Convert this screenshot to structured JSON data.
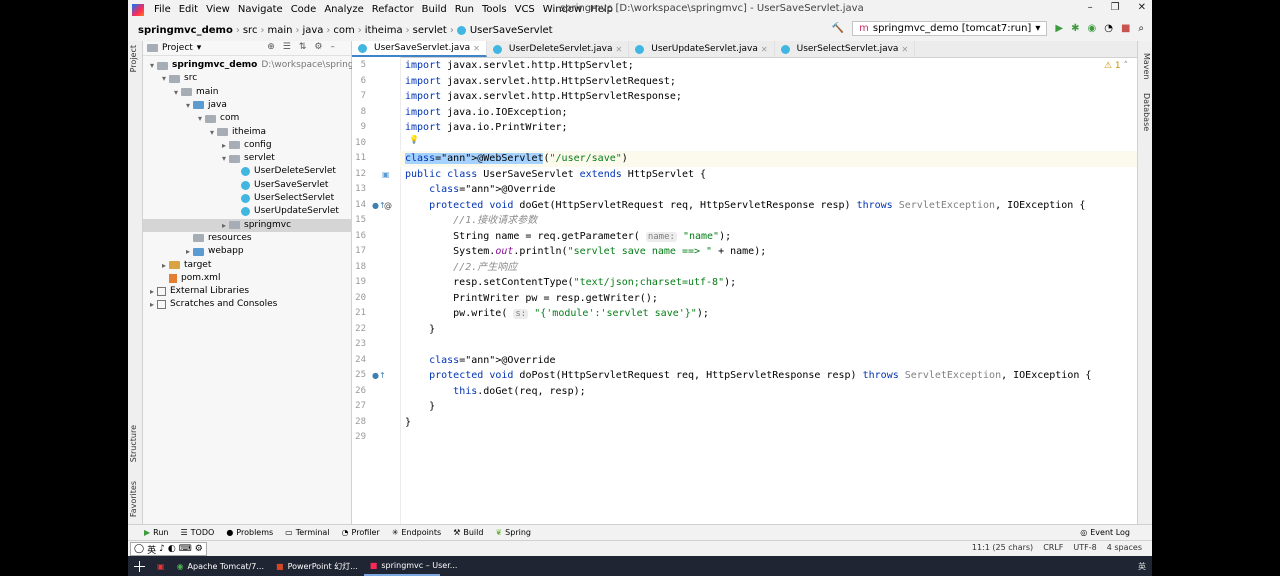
{
  "window": {
    "title": "springmvc [D:\\workspace\\springmvc] - UserSaveServlet.java",
    "menu": [
      "File",
      "Edit",
      "View",
      "Navigate",
      "Code",
      "Analyze",
      "Refactor",
      "Build",
      "Run",
      "Tools",
      "VCS",
      "Window",
      "Help"
    ],
    "controls": [
      "–",
      "❐",
      "✕"
    ]
  },
  "breadcrumb": [
    "springmvc_demo",
    "src",
    "main",
    "java",
    "com",
    "itheima",
    "servlet",
    "UserSaveServlet"
  ],
  "run_config": "springmvc_demo [tomcat7:run]",
  "project": {
    "header": "Project",
    "tree": [
      {
        "label": "springmvc_demo",
        "path": "D:\\workspace\\springmvc",
        "indent": 0,
        "arrow": "▾",
        "icon": "fold grey"
      },
      {
        "label": "src",
        "indent": 1,
        "arrow": "▾",
        "icon": "fold grey"
      },
      {
        "label": "main",
        "indent": 2,
        "arrow": "▾",
        "icon": "fold grey"
      },
      {
        "label": "java",
        "indent": 3,
        "arrow": "▾",
        "icon": "fold blue"
      },
      {
        "label": "com",
        "indent": 4,
        "arrow": "▾",
        "icon": "fold grey"
      },
      {
        "label": "itheima",
        "indent": 5,
        "arrow": "▾",
        "icon": "fold grey"
      },
      {
        "label": "config",
        "indent": 6,
        "arrow": "▸",
        "icon": "fold grey"
      },
      {
        "label": "servlet",
        "indent": 6,
        "arrow": "▾",
        "icon": "fold grey"
      },
      {
        "label": "UserDeleteServlet",
        "indent": 7,
        "arrow": "",
        "icon": "cls"
      },
      {
        "label": "UserSaveServlet",
        "indent": 7,
        "arrow": "",
        "icon": "cls"
      },
      {
        "label": "UserSelectServlet",
        "indent": 7,
        "arrow": "",
        "icon": "cls"
      },
      {
        "label": "UserUpdateServlet",
        "indent": 7,
        "arrow": "",
        "icon": "cls"
      },
      {
        "label": "springmvc",
        "indent": 6,
        "arrow": "▸",
        "icon": "fold grey",
        "selected": true
      },
      {
        "label": "resources",
        "indent": 3,
        "arrow": "",
        "icon": "fold grey"
      },
      {
        "label": "webapp",
        "indent": 3,
        "arrow": "▸",
        "icon": "fold blue"
      },
      {
        "label": "target",
        "indent": 1,
        "arrow": "▸",
        "icon": "fold orange"
      },
      {
        "label": "pom.xml",
        "indent": 1,
        "arrow": "",
        "icon": "xml"
      },
      {
        "label": "External Libraries",
        "indent": 0,
        "arrow": "▸",
        "icon": "lib"
      },
      {
        "label": "Scratches and Consoles",
        "indent": 0,
        "arrow": "▸",
        "icon": "lib"
      }
    ]
  },
  "side_left": [
    "Project",
    "Structure",
    "Favorites"
  ],
  "side_right": [
    "Maven",
    "Database"
  ],
  "tabs": [
    "UserSaveServlet.java",
    "UserDeleteServlet.java",
    "UserUpdateServlet.java",
    "UserSelectServlet.java"
  ],
  "warning_count": "1",
  "code": {
    "first_line": 5,
    "lines": [
      "import javax.servlet.http.HttpServlet;",
      "import javax.servlet.http.HttpServletRequest;",
      "import javax.servlet.http.HttpServletResponse;",
      "import java.io.IOException;",
      "import java.io.PrintWriter;",
      "",
      "@WebServlet(\"/user/save\")",
      "public class UserSaveServlet extends HttpServlet {",
      "    @Override",
      "    protected void doGet(HttpServletRequest req, HttpServletResponse resp) throws ServletException, IOException {",
      "        //1.接收请求参数",
      "        String name = req.getParameter( name: \"name\");",
      "        System.out.println(\"servlet save name ==> \" + name);",
      "        //2.产生响应",
      "        resp.setContentType(\"text/json;charset=utf-8\");",
      "        PrintWriter pw = resp.getWriter();",
      "        pw.write( s: \"{'module':'servlet save'}\");",
      "    }",
      "",
      "    @Override",
      "    protected void doPost(HttpServletRequest req, HttpServletResponse resp) throws ServletException, IOException {",
      "        this.doGet(req, resp);",
      "    }",
      "}",
      ""
    ]
  },
  "bottom_tools": [
    "Run",
    "TODO",
    "Problems",
    "Terminal",
    "Profiler",
    "Endpoints",
    "Build",
    "Spring"
  ],
  "event_log": "Event Log",
  "status": {
    "ime": [
      "英",
      "♪",
      "◐",
      "⌨",
      "⚙"
    ],
    "position": "11:1 (25 chars)",
    "line_sep": "CRLF",
    "encoding": "UTF-8",
    "indent": "4 spaces"
  },
  "taskbar": {
    "apps": [
      "Apache Tomcat/7...",
      "PowerPoint 幻灯...",
      "springmvc – User..."
    ],
    "tray": "英"
  }
}
